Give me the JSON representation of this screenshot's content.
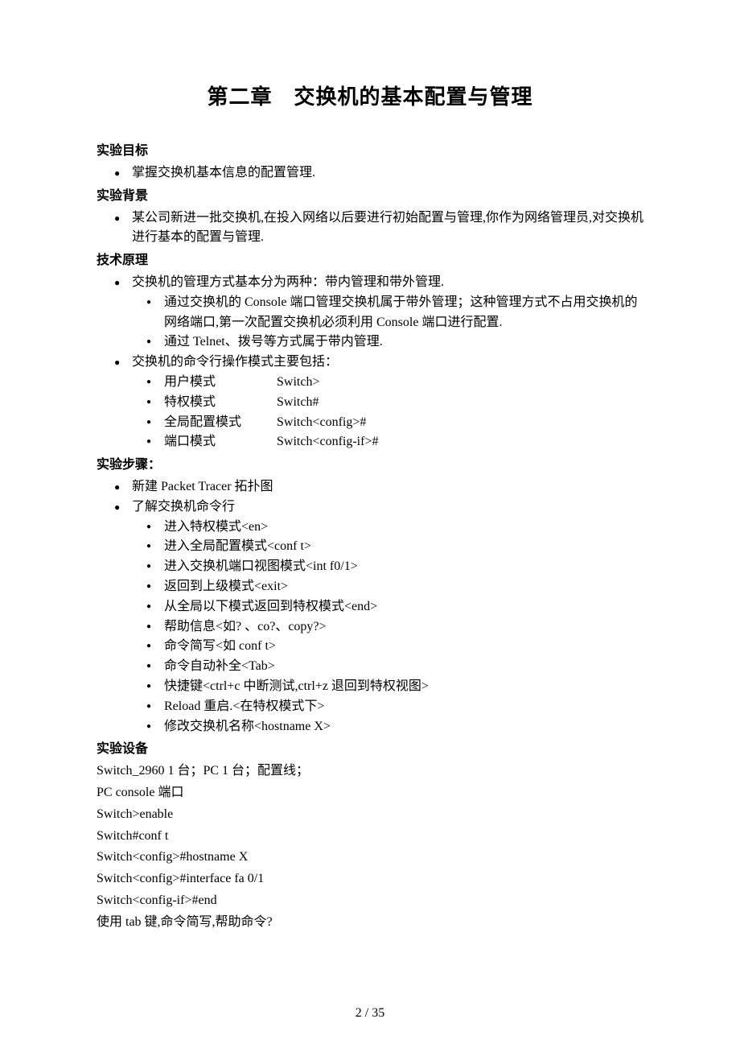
{
  "title": "第二章　交换机的基本配置与管理",
  "h": {
    "goal": "实验目标",
    "bg": "实验背景",
    "tech": "技术原理",
    "steps": "实验步骤：",
    "equip": "实验设备"
  },
  "goal_items": [
    "掌握交换机基本信息的配置管理."
  ],
  "bg_items": [
    "某公司新进一批交换机,在投入网络以后要进行初始配置与管理,你作为网络管理员,对交换机进行基本的配置与管理."
  ],
  "tech": {
    "mgmt_intro": "交换机的管理方式基本分为两种：带内管理和带外管理.",
    "mgmt_sub": [
      "通过交换机的 Console 端口管理交换机属于带外管理；这种管理方式不占用交换机的网络端口,第一次配置交换机必须利用 Console 端口进行配置.",
      "通过 Telnet、拨号等方式属于带内管理."
    ],
    "mode_intro": "交换机的命令行操作模式主要包括：",
    "modes": [
      {
        "label": "用户模式",
        "prompt": "Switch>"
      },
      {
        "label": "特权模式",
        "prompt": "Switch#"
      },
      {
        "label": "全局配置模式",
        "prompt": "Switch<config>#"
      },
      {
        "label": "端口模式",
        "prompt": "Switch<config-if>#"
      }
    ]
  },
  "steps": {
    "top": [
      "新建 Packet Tracer 拓扑图",
      "了解交换机命令行"
    ],
    "sub": [
      "进入特权模式<en>",
      "进入全局配置模式<conf t>",
      "进入交换机端口视图模式<int f0/1>",
      "返回到上级模式<exit>",
      "从全局以下模式返回到特权模式<end>",
      "帮助信息<如? 、co?、copy?>",
      "命令简写<如  conf t>",
      "命令自动补全<Tab>",
      "快捷键<ctrl+c 中断测试,ctrl+z 退回到特权视图>",
      "Reload 重启.<在特权模式下>",
      "修改交换机名称<hostname X>"
    ]
  },
  "equip_lines": [
    "Switch_2960 1 台；PC 1 台；配置线；",
    "PC console 端口",
    "Switch>enable",
    "Switch#conf t",
    "Switch<config>#hostname X",
    "Switch<config>#interface fa 0/1",
    "Switch<config-if>#end",
    "使用 tab 键,命令简写,帮助命令?"
  ],
  "pagenum": "2  / 35"
}
